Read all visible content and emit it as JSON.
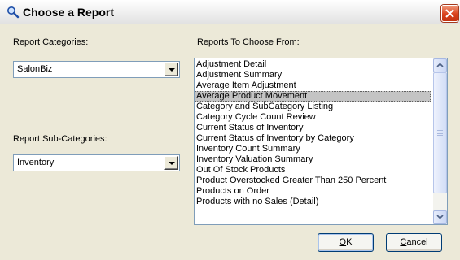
{
  "window": {
    "title": "Choose a Report",
    "close_glyph": "✕"
  },
  "categories": {
    "label": "Report Categories:",
    "value": "SalonBiz"
  },
  "subcategories": {
    "label": "Report Sub-Categories:",
    "value": "Inventory"
  },
  "reports": {
    "label": "Reports To Choose From:",
    "selected_index": 3,
    "items": [
      "Adjustment Detail",
      "Adjustment Summary",
      "Average Item Adjustment",
      "Average Product Movement",
      "Category and SubCategory Listing",
      "Category Cycle Count Review",
      "Current Status of Inventory",
      "Current Status of Inventory by Category",
      "Inventory Count Summary",
      "Inventory Valuation Summary",
      "Out Of Stock Products",
      "Product Overstocked Greater Than 250 Percent",
      "Products on Order",
      "Products with no Sales (Detail)"
    ]
  },
  "buttons": {
    "ok_mnemonic": "O",
    "ok_rest": "K",
    "cancel_mnemonic": "C",
    "cancel_rest": "ancel"
  },
  "icons": {
    "title": "magnifier-icon",
    "close": "close-icon",
    "dropdown": "chevron-down-icon",
    "scroll_up": "scroll-up-arrow-icon",
    "scroll_down": "scroll-down-arrow-icon"
  },
  "colors": {
    "selection": "#c4c4c4",
    "close_button": "#d9411b",
    "dialog_face": "#ece9d8"
  }
}
